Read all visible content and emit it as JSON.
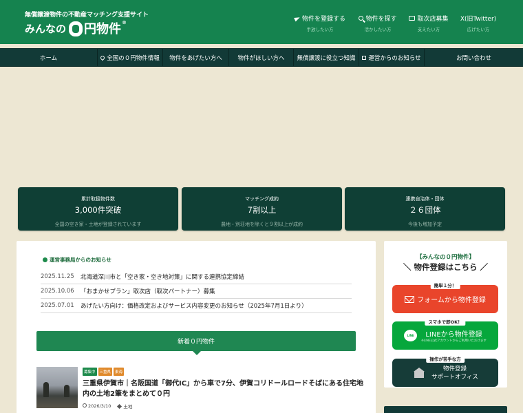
{
  "header": {
    "tagline": "無償譲渡物件の不動産マッチング支援サイト",
    "logo": {
      "pre": "みんなの",
      "post": "円物件",
      "reg": "®"
    },
    "nav": [
      {
        "label": "物件を登録する",
        "sub": "手放したい方",
        "icon": "send-icon"
      },
      {
        "label": "物件を探す",
        "sub": "活かしたい方",
        "icon": "search-icon"
      },
      {
        "label": "取次店募集",
        "sub": "支えたい方",
        "icon": "card-icon"
      },
      {
        "label": "X(旧Twitter)",
        "sub": "広げたい方",
        "icon": ""
      }
    ]
  },
  "menu": [
    "ホーム",
    "全国の０円物件情報",
    "物件をあげたい方へ",
    "物件がほしい方へ",
    "無償譲渡に役立つ知識",
    "運営からのお知らせ",
    "お問い合わせ"
  ],
  "stats": [
    {
      "label": "累計取扱物件数",
      "value": "3,000件突破",
      "note": "全国の空き家・土地が登録されています"
    },
    {
      "label": "マッチング成約",
      "value": "7割以上",
      "note": "農地・別荘地を除くと９割以上が成約"
    },
    {
      "label": "連携自治体・団体",
      "value": "２６団体",
      "note": "今後も増加予定"
    }
  ],
  "news": {
    "heading": "運営事務局からのお知らせ",
    "items": [
      {
        "date": "2025.11.25",
        "title": "北海道深川市と「空き家・空き地対策」に関する連携協定締結"
      },
      {
        "date": "2025.10.06",
        "title": "「おまかせプラン」取次店（取次パートナー）募集"
      },
      {
        "date": "2025.07.01",
        "title": "あげたい方向け：価格改定およびサービス内容変更のお知らせ（2025年7月1日より）"
      }
    ]
  },
  "newest": {
    "heading": "新着０円物件",
    "post": {
      "tags": [
        {
          "label": "募集中",
          "color": "#1d8a4b"
        },
        {
          "label": "三重県",
          "color": "#e08a2c"
        },
        {
          "label": "東海",
          "color": "#e08a2c"
        }
      ],
      "title": "三重県伊賀市｜名阪国道「御代IC」から車で7分、伊賀コリドールロードそばにある住宅地内の土地2筆をまとめて０円",
      "date": "2026/3/10",
      "category": "土地"
    }
  },
  "sidebar": {
    "title": "【みんなの０円物件】",
    "subtitle": "＼ 物件登録はこちら ／",
    "buttons": [
      {
        "badge": "簡単１分！",
        "label": "フォームから物件登録",
        "color": "#e9452b"
      },
      {
        "badge": "スマホで即OK！",
        "label": "LINEから物件登録",
        "sub": "※LINE公式アカウントからご利用いただけます",
        "icon_text": "LINE",
        "color": "#06a73c"
      },
      {
        "badge": "操作が苦手な方",
        "label": "物件登録",
        "label2": "サポートオフィス",
        "color": "#163c38"
      }
    ]
  },
  "colors": {
    "brand": "#15834f",
    "menubar": "#123a37",
    "background": "#ede7d3"
  }
}
